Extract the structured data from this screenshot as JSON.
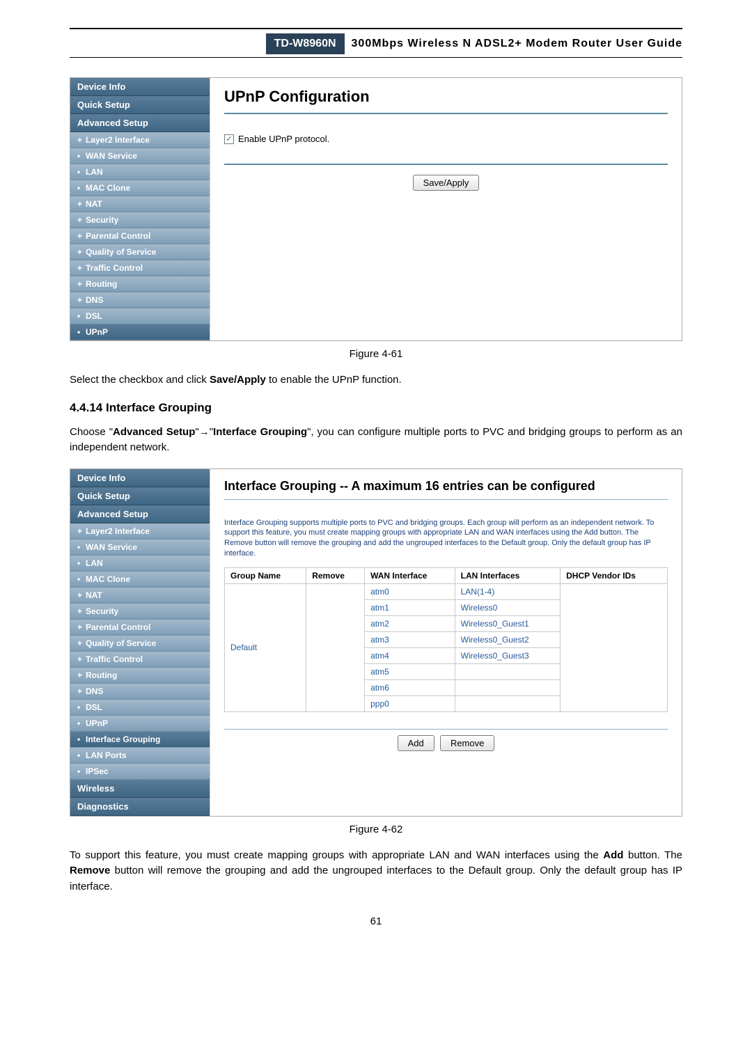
{
  "header": {
    "model": "TD-W8960N",
    "title": "300Mbps Wireless N ADSL2+ Modem Router User Guide"
  },
  "panel1": {
    "sidebar": {
      "top": [
        "Device Info",
        "Quick Setup",
        "Advanced Setup"
      ],
      "subs": [
        {
          "prefix": "+",
          "label": "Layer2 Interface"
        },
        {
          "prefix": "•",
          "label": "WAN Service"
        },
        {
          "prefix": "•",
          "label": "LAN"
        },
        {
          "prefix": "•",
          "label": "MAC Clone"
        },
        {
          "prefix": "+",
          "label": "NAT"
        },
        {
          "prefix": "+",
          "label": "Security"
        },
        {
          "prefix": "+",
          "label": "Parental Control"
        },
        {
          "prefix": "+",
          "label": "Quality of Service"
        },
        {
          "prefix": "+",
          "label": "Traffic Control"
        },
        {
          "prefix": "+",
          "label": "Routing"
        },
        {
          "prefix": "+",
          "label": "DNS"
        },
        {
          "prefix": "•",
          "label": "DSL"
        },
        {
          "prefix": "•",
          "label": "UPnP",
          "highlight": true
        }
      ]
    },
    "content": {
      "title": "UPnP Configuration",
      "checkbox_label": "Enable UPnP protocol.",
      "button": "Save/Apply"
    },
    "caption": "Figure 4-61"
  },
  "text1": {
    "pre": "Select the checkbox and click ",
    "bold": "Save/Apply",
    "post": " to enable the UPnP function."
  },
  "section": {
    "heading": "4.4.14 Interface Grouping",
    "para_parts": [
      "Choose \"",
      "Advanced Setup",
      "\"→\"",
      "Interface Grouping",
      "\", you can configure multiple ports to PVC and bridging groups to perform as an independent network."
    ]
  },
  "panel2": {
    "sidebar": {
      "top": [
        "Device Info",
        "Quick Setup",
        "Advanced Setup"
      ],
      "subs": [
        {
          "prefix": "+",
          "label": "Layer2 Interface"
        },
        {
          "prefix": "•",
          "label": "WAN Service"
        },
        {
          "prefix": "•",
          "label": "LAN"
        },
        {
          "prefix": "•",
          "label": "MAC Clone"
        },
        {
          "prefix": "+",
          "label": "NAT"
        },
        {
          "prefix": "+",
          "label": "Security"
        },
        {
          "prefix": "+",
          "label": "Parental Control"
        },
        {
          "prefix": "+",
          "label": "Quality of Service"
        },
        {
          "prefix": "+",
          "label": "Traffic Control"
        },
        {
          "prefix": "+",
          "label": "Routing"
        },
        {
          "prefix": "+",
          "label": "DNS"
        },
        {
          "prefix": "•",
          "label": "DSL"
        },
        {
          "prefix": "•",
          "label": "UPnP"
        },
        {
          "prefix": "•",
          "label": "Interface Grouping",
          "highlight": true
        },
        {
          "prefix": "•",
          "label": "LAN Ports"
        },
        {
          "prefix": "•",
          "label": "IPSec"
        }
      ],
      "bottom": [
        "Wireless",
        "Diagnostics"
      ]
    },
    "content": {
      "title": "Interface Grouping -- A maximum 16 entries can be configured",
      "desc": "Interface Grouping supports multiple ports to PVC and bridging groups. Each group will perform as an independent network. To support this feature, you must create mapping groups with appropriate LAN and WAN interfaces using the Add button. The Remove button will remove the grouping and add the ungrouped interfaces to the Default group. Only the default group has IP interface.",
      "table": {
        "headers": [
          "Group Name",
          "Remove",
          "WAN Interface",
          "LAN Interfaces",
          "DHCP Vendor IDs"
        ],
        "group_name": "Default",
        "rows": [
          {
            "wan": "atm0",
            "lan": "LAN(1-4)"
          },
          {
            "wan": "atm1",
            "lan": "Wireless0"
          },
          {
            "wan": "atm2",
            "lan": "Wireless0_Guest1"
          },
          {
            "wan": "atm3",
            "lan": "Wireless0_Guest2"
          },
          {
            "wan": "atm4",
            "lan": "Wireless0_Guest3"
          },
          {
            "wan": "atm5",
            "lan": ""
          },
          {
            "wan": "atm6",
            "lan": ""
          },
          {
            "wan": "ppp0",
            "lan": ""
          }
        ]
      },
      "buttons": [
        "Add",
        "Remove"
      ]
    },
    "caption": "Figure 4-62"
  },
  "text2": {
    "parts": [
      "To support this feature, you must create mapping groups with appropriate LAN and WAN interfaces using the ",
      "Add",
      " button. The ",
      "Remove",
      " button will remove the grouping and add the ungrouped interfaces to the Default group. Only the default group has IP interface."
    ]
  },
  "page_number": "61"
}
